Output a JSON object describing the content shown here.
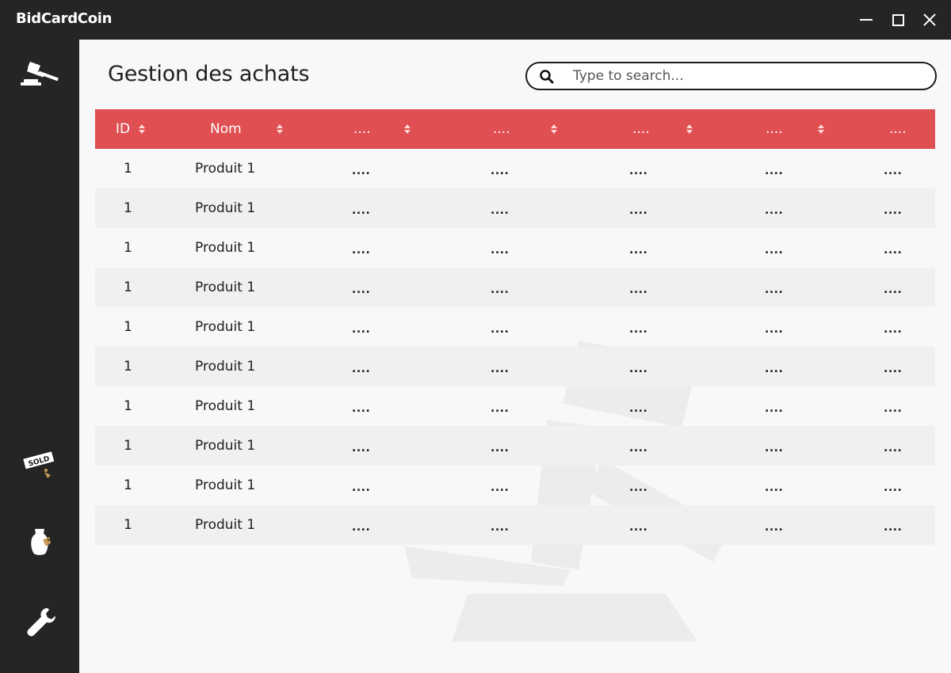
{
  "window": {
    "title": "BidCardCoin"
  },
  "sidebar": {
    "items": [
      {
        "icon": "gavel-icon"
      },
      {
        "icon": "sold-tag-icon"
      },
      {
        "icon": "vase-tag-icon"
      },
      {
        "icon": "wrench-icon"
      }
    ]
  },
  "page": {
    "title": "Gestion des achats"
  },
  "search": {
    "placeholder": "Type to search...",
    "value": ""
  },
  "table": {
    "columns": [
      "ID",
      "Nom",
      "....",
      "....",
      "....",
      "....",
      "...."
    ],
    "rows": [
      [
        "1",
        "Produit 1",
        "....",
        "....",
        "....",
        "....",
        "...."
      ],
      [
        "1",
        "Produit 1",
        "....",
        "....",
        "....",
        "....",
        "...."
      ],
      [
        "1",
        "Produit 1",
        "....",
        "....",
        "....",
        "....",
        "...."
      ],
      [
        "1",
        "Produit 1",
        "....",
        "....",
        "....",
        "....",
        "...."
      ],
      [
        "1",
        "Produit 1",
        "....",
        "....",
        "....",
        "....",
        "...."
      ],
      [
        "1",
        "Produit 1",
        "....",
        "....",
        "....",
        "....",
        "...."
      ],
      [
        "1",
        "Produit 1",
        "....",
        "....",
        "....",
        "....",
        "...."
      ],
      [
        "1",
        "Produit 1",
        "....",
        "....",
        "....",
        "....",
        "...."
      ],
      [
        "1",
        "Produit 1",
        "....",
        "....",
        "....",
        "....",
        "...."
      ],
      [
        "1",
        "Produit 1",
        "....",
        "....",
        "....",
        "....",
        "...."
      ]
    ]
  },
  "colors": {
    "header_bg": "#e04f51",
    "sidebar_bg": "#252525",
    "page_bg": "#f8f7fa",
    "stripe_bg": "#f0f0f2"
  }
}
